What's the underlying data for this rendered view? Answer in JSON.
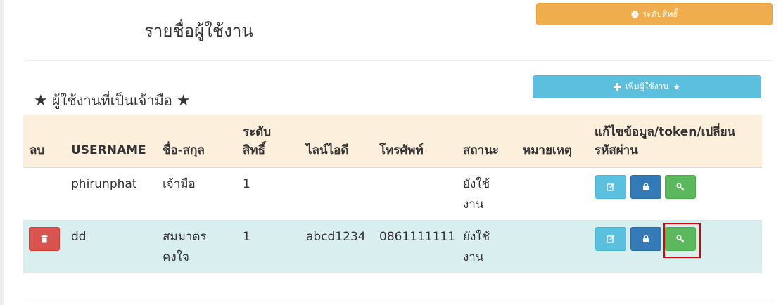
{
  "header": {
    "title": "รายชื่อผู้ใช้งาน",
    "rights_button": "ระดับสิทธิ์"
  },
  "section": {
    "title": "ผู้ใช้งานที่เป็นเจ้ามือ",
    "add_button": "เพิ่มผู้ใช้งาน"
  },
  "table": {
    "headers": {
      "delete": "ลบ",
      "username": "USERNAME",
      "fullname": "ชื่อ-สกุล",
      "level_1": "ระดับ",
      "level_2": "สิทธิ์",
      "line_id": "ไลน์ไอดี",
      "phone": "โทรศัพท์",
      "status": "สถานะ",
      "note": "หมายเหตุ",
      "actions_1": "แก้ไขข้อมูล/token/เปลี่ยน",
      "actions_2": "รหัสผ่าน"
    },
    "rows": [
      {
        "username": "phirunphat",
        "fullname_1": "เจ้ามือ",
        "fullname_2": "",
        "level": "1",
        "line_id": "",
        "phone": "",
        "status_1": "ยังใช้",
        "status_2": "งาน",
        "note": "",
        "has_delete": false
      },
      {
        "username": "dd",
        "fullname_1": "สมมาตร",
        "fullname_2": "คงใจ",
        "level": "1",
        "line_id": "abcd1234",
        "phone": "0861111111",
        "status_1": "ยังใช้",
        "status_2": "งาน",
        "note": "",
        "has_delete": true
      }
    ]
  },
  "colors": {
    "warning": "#f0ad4e",
    "info": "#5bc0de",
    "primary": "#337ab7",
    "success": "#5cb85c",
    "danger": "#d9534f",
    "header_bg": "#fcefdc",
    "row_alt_bg": "#d9eeee",
    "highlight": "#e00000"
  },
  "icons": {
    "rights": "info-circle-icon",
    "add": "plus-icon",
    "star": "star-icon",
    "edit": "edit-icon",
    "lock": "lock-icon",
    "key": "key-icon",
    "delete": "trash-icon"
  }
}
